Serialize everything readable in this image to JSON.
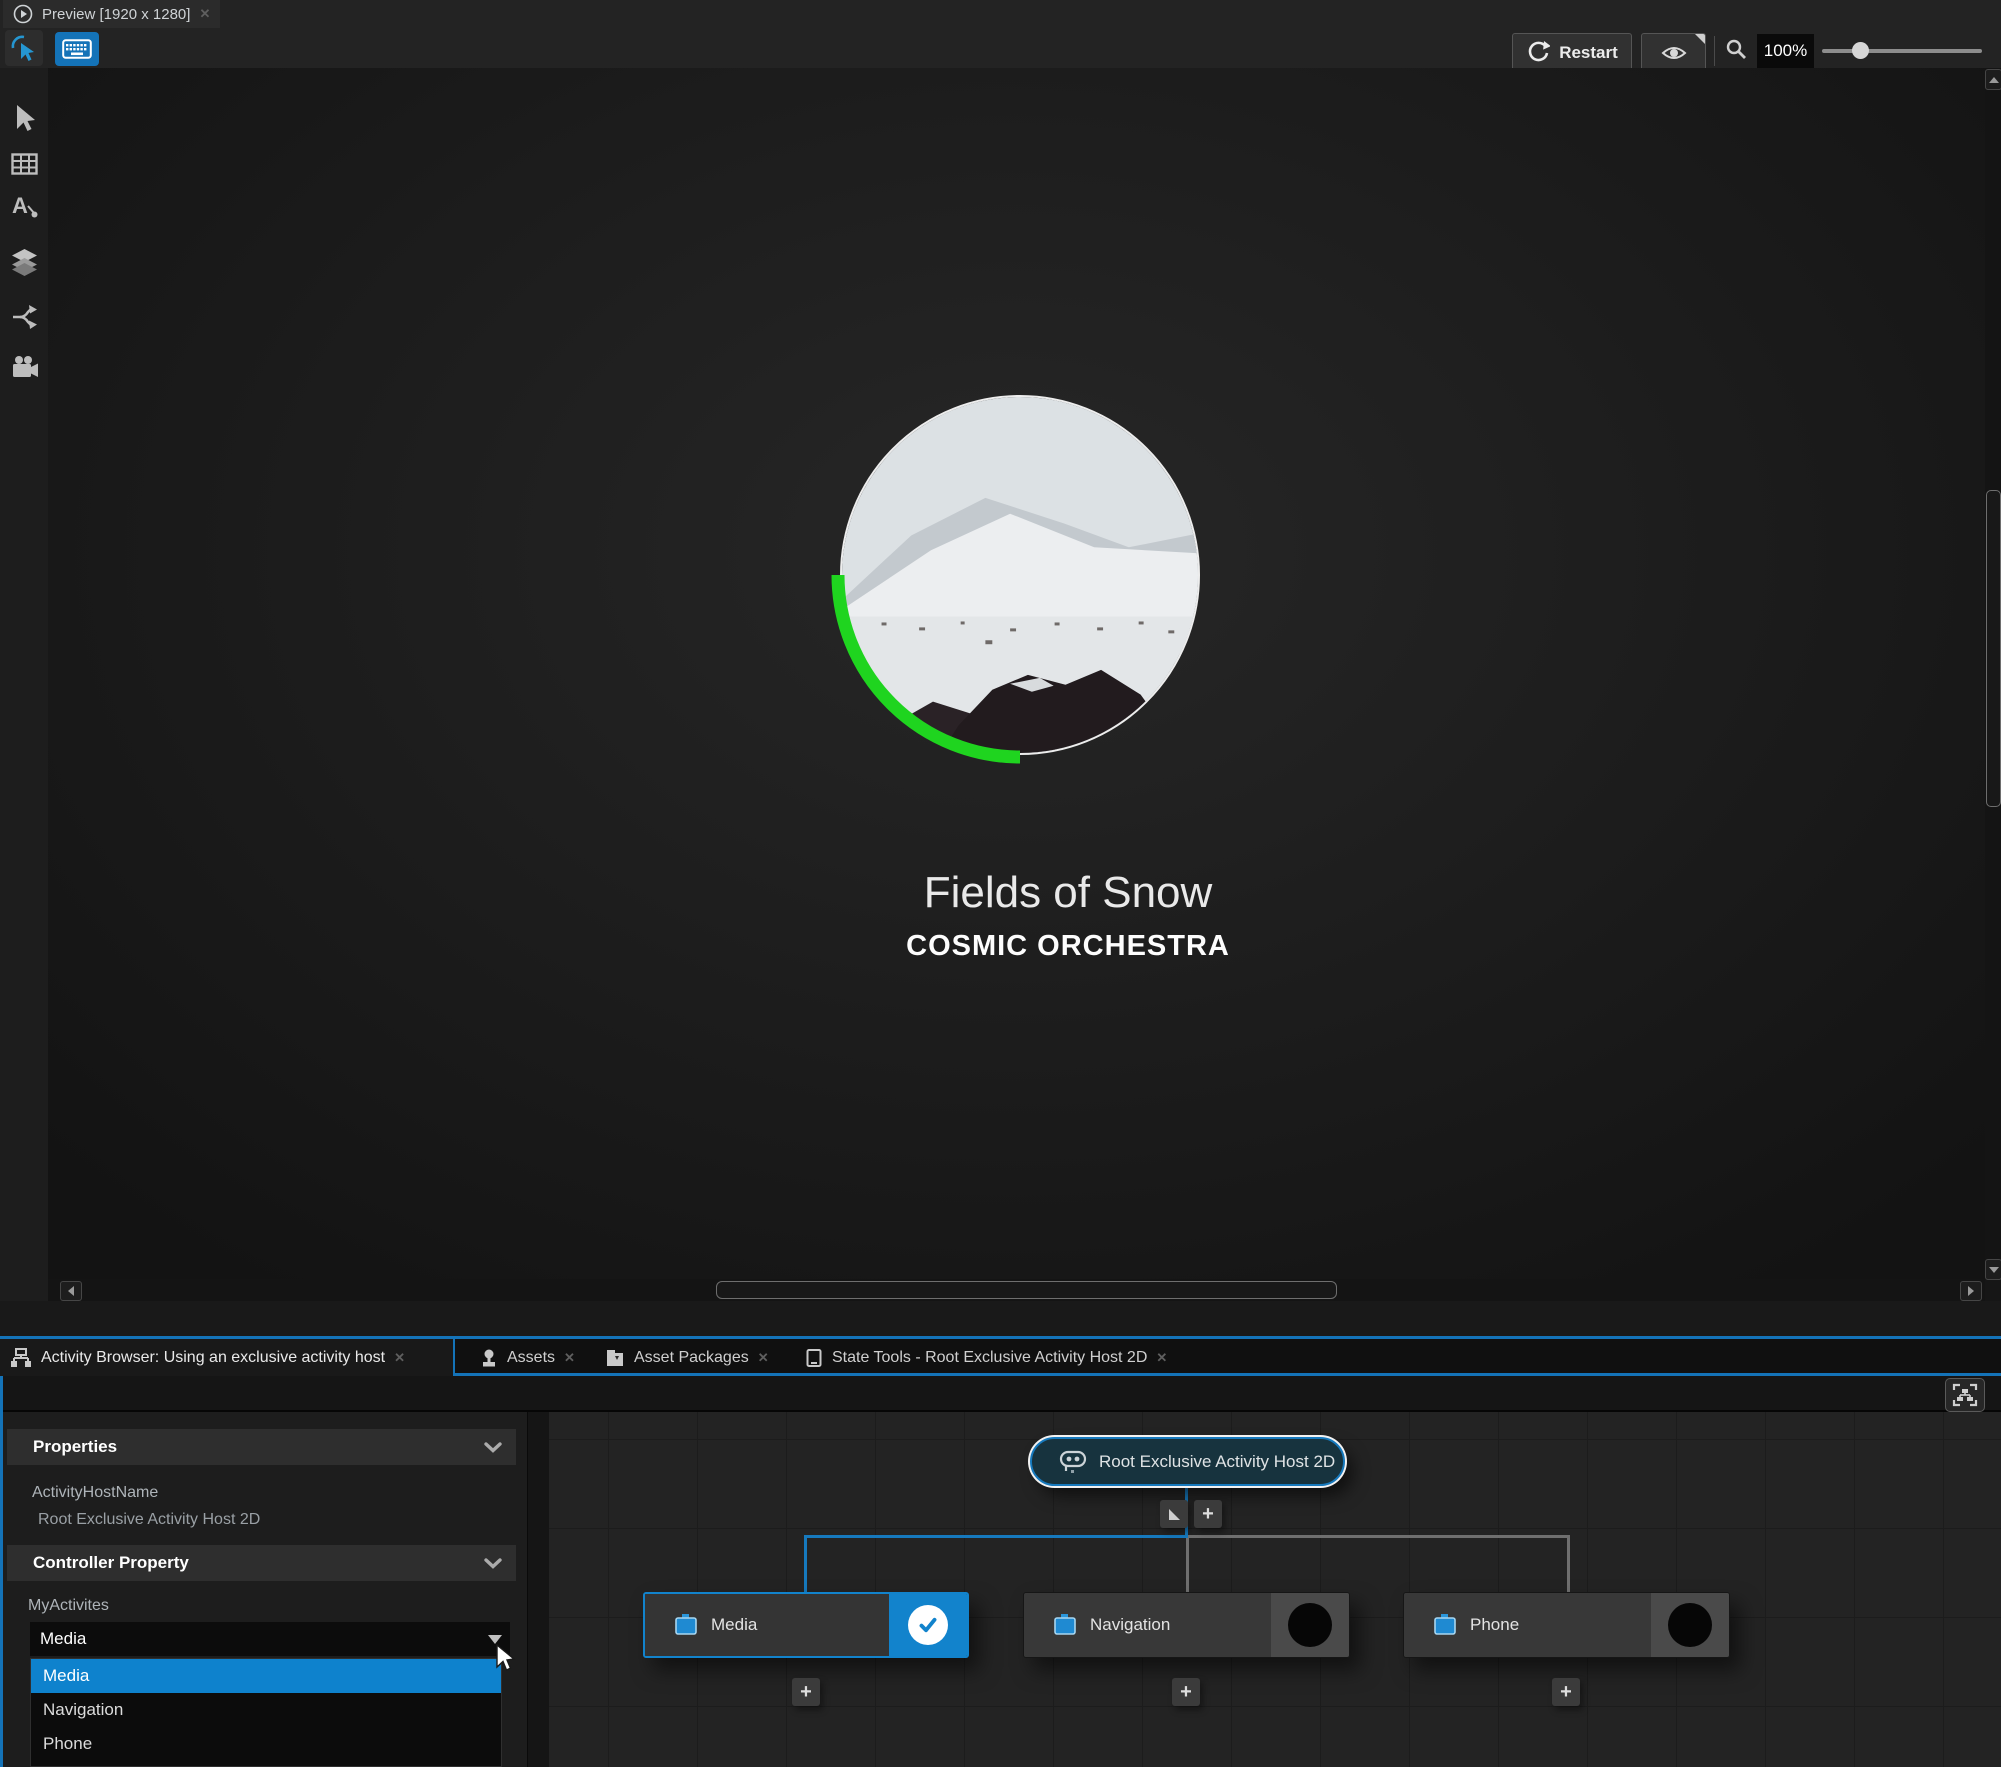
{
  "colors": {
    "accent_blue": "#1473b8",
    "selection_blue": "#0e82cd",
    "progress_green": "#1fd41f",
    "node_teal": "#17333e"
  },
  "top": {
    "preview_tab": {
      "label": "Preview [1920 x 1280]",
      "close": "✕"
    },
    "toolbar": {
      "restart_label": "Restart",
      "zoom_value": "100%"
    }
  },
  "player": {
    "title": "Fields of Snow",
    "artist": "COSMIC ORCHESTRA"
  },
  "bottom": {
    "tabs": [
      {
        "label": "Activity Browser: Using an exclusive activity host",
        "close": "✕",
        "active": true
      },
      {
        "label": "Assets",
        "close": "✕",
        "active": false
      },
      {
        "label": "Asset Packages",
        "close": "✕",
        "active": false
      },
      {
        "label": "State Tools - Root Exclusive Activity Host 2D",
        "close": "✕",
        "active": false
      }
    ],
    "properties_panel": {
      "section_properties": "Properties",
      "activity_host_name_label": "ActivityHostName",
      "activity_host_name_value": "Root Exclusive Activity Host 2D",
      "section_controller": "Controller Property",
      "controller_property_label": "MyActivites",
      "dropdown": {
        "value": "Media",
        "selected": "Media",
        "options": [
          "Media",
          "Navigation",
          "Phone"
        ]
      }
    },
    "graph": {
      "root_node": "Root Exclusive Activity Host 2D",
      "nodes": [
        {
          "label": "Media",
          "state": "active"
        },
        {
          "label": "Navigation",
          "state": "inactive"
        },
        {
          "label": "Phone",
          "state": "inactive"
        }
      ],
      "add_button": "+"
    }
  }
}
